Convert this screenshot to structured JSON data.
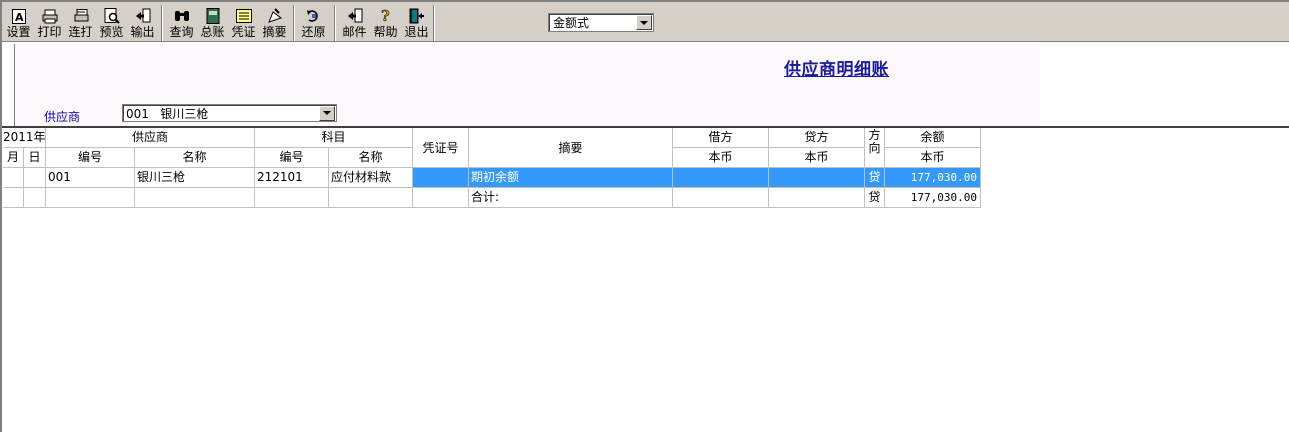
{
  "toolbar": {
    "buttons": [
      {
        "label": "设置",
        "icon": "settings-icon"
      },
      {
        "label": "打印",
        "icon": "printer-icon"
      },
      {
        "label": "连打",
        "icon": "batch-print-icon"
      },
      {
        "label": "预览",
        "icon": "preview-icon"
      },
      {
        "label": "输出",
        "icon": "export-icon"
      },
      {
        "label": "查询",
        "icon": "binoculars-icon"
      },
      {
        "label": "总账",
        "icon": "ledger-book-icon"
      },
      {
        "label": "凭证",
        "icon": "voucher-icon"
      },
      {
        "label": "摘要",
        "icon": "summary-icon"
      },
      {
        "label": "还原",
        "icon": "restore-icon"
      },
      {
        "label": "邮件",
        "icon": "mail-icon"
      },
      {
        "label": "帮助",
        "icon": "help-icon"
      },
      {
        "label": "退出",
        "icon": "exit-icon"
      }
    ],
    "mode_select": "金额式"
  },
  "report": {
    "title": "供应商明细账",
    "supplier_label": "供应商",
    "supplier_value": "001   银川三枪"
  },
  "table": {
    "year": "2011年",
    "month": "月",
    "day": "日",
    "supplier_group": "供应商",
    "supplier_code": "编号",
    "supplier_name": "名称",
    "subject_group": "科目",
    "subject_code": "编号",
    "subject_name": "名称",
    "voucher_no": "凭证号",
    "summary": "摘要",
    "debit": "借方",
    "credit": "贷方",
    "debit_currency": "本币",
    "credit_currency": "本币",
    "direction": "方向",
    "balance": "余额",
    "balance_currency": "本币",
    "rows": [
      {
        "month": "",
        "day": "",
        "supplier_code": "001",
        "supplier_name": "银川三枪",
        "subject_code": "212101",
        "subject_name": "应付材料款",
        "voucher": "",
        "summary": "期初余额",
        "debit": "",
        "credit": "",
        "direction": "贷",
        "balance": "177,030.00"
      },
      {
        "month": "",
        "day": "",
        "supplier_code": "",
        "supplier_name": "",
        "subject_code": "",
        "subject_name": "",
        "voucher": "",
        "summary": "合计:",
        "debit": "",
        "credit": "",
        "direction": "贷",
        "balance": "177,030.00"
      }
    ]
  }
}
